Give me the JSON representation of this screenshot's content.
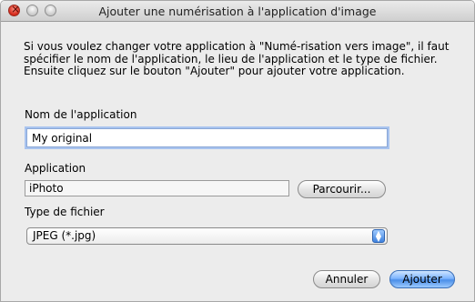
{
  "window": {
    "title": "Ajouter une numérisation à l'application d'image"
  },
  "intro_text": "Si vous voulez changer votre application à \"Numé-risation vers image\", il faut spécifier le nom de l'application, le lieu de l'application et le type de fichier. Ensuite cliquez sur le bouton \"Ajouter\" pour ajouter votre application.",
  "name_section": {
    "label": "Nom de l'application",
    "value": "My original"
  },
  "app_section": {
    "label": "Application",
    "value": "iPhoto",
    "browse_label": "Parcourir..."
  },
  "type_section": {
    "label": "Type de fichier",
    "selected": "JPEG (*.jpg)"
  },
  "buttons": {
    "cancel": "Annuler",
    "add": "Ajouter"
  },
  "colors": {
    "accent": "#4b8fe8",
    "window_bg": "#ececec",
    "focus_ring": "#a9c4ef"
  },
  "icons": {
    "close": "close-icon",
    "minimize": "minimize-icon",
    "zoom": "zoom-icon",
    "select_arrows": "updown-arrows-icon"
  }
}
